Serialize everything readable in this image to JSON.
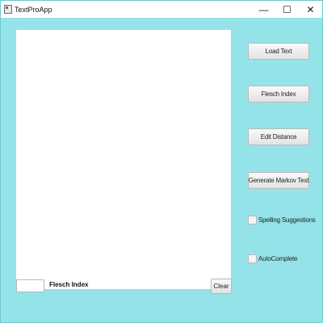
{
  "window": {
    "title": "TextProApp",
    "minimize_glyph": "—",
    "maximize_glyph": "☐",
    "close_glyph": "✕"
  },
  "sidebar": {
    "load_text": "Load Text",
    "flesch_index": "Flesch Index",
    "edit_distance": "Edit Distance",
    "generate_markov": "Generate Markov Text",
    "spelling_suggestions": "Spelling Suggestions",
    "autocomplete": "AutoComplete"
  },
  "bottom": {
    "flesch_value": "",
    "flesch_label": "Flesch Index",
    "clear": "Clear"
  },
  "editor": {
    "text": ""
  },
  "colors": {
    "background": "#94e3e9"
  }
}
